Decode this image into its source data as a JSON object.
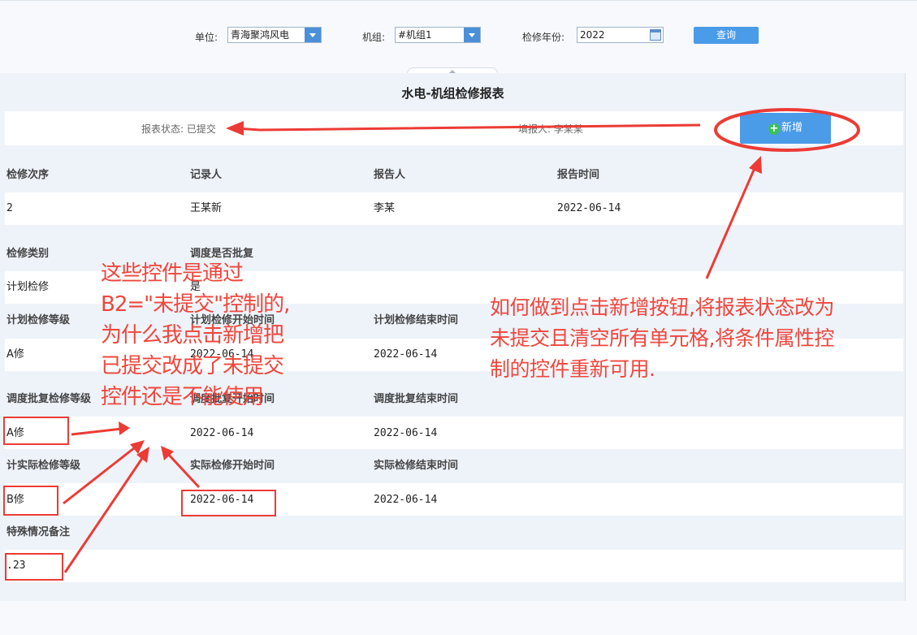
{
  "filters": {
    "unit_label": "单位:",
    "unit_value": "青海聚鸿风电",
    "unit_label_text": "单位:",
    "group_label": "机组:",
    "group_value": "#机组1",
    "year_label": "检修年份:",
    "year_value": "2022",
    "query_label": "查询"
  },
  "report": {
    "title": "水电-机组检修报表",
    "status": "报表状态: 已提交",
    "filler": "填报人: 李某某",
    "add_label": "新增"
  },
  "sections": {
    "s1": {
      "headers": [
        "检修次序",
        "记录人",
        "报告人",
        "报告时间"
      ],
      "values": [
        "2",
        "王某新",
        "李某",
        "2022-06-14"
      ]
    },
    "s2": {
      "headers": [
        "检修类别",
        "调度是否批复"
      ],
      "values": [
        "计划检修",
        "是"
      ]
    },
    "s3": {
      "headers": [
        "计划检修等级",
        "计划检修开始时间",
        "计划检修结束时间"
      ],
      "values": [
        "A修",
        "2022-06-14",
        "2022-06-14"
      ]
    },
    "s4": {
      "headers": [
        "调度批复检修等级",
        "调度批复开始时间",
        "调度批复结束时间"
      ],
      "values": [
        "A修",
        "2022-06-14",
        "2022-06-14"
      ]
    },
    "s5": {
      "headers": [
        "计实际检修等级",
        "实际检修开始时间",
        "实际检修结束时间"
      ],
      "values": [
        "B修",
        "2022-06-14",
        "2022-06-14"
      ]
    },
    "s6": {
      "headers": [
        "特殊情况备注"
      ],
      "values": [
        ".23"
      ]
    }
  },
  "annotations": {
    "left": [
      "这些控件是通过",
      "B2=\"未提交\"控制的,",
      "为什么我点击新增把",
      "已提交改成了未提交",
      "控件还是不能使用"
    ],
    "right": [
      "如何做到点击新增按钮,将报表状态改为",
      "未提交且清空所有单元格,将条件属性控",
      "制的控件重新可用."
    ]
  },
  "colors": {
    "accent": "#4a9be8",
    "annotation": "#f0463c",
    "add_icon": "#3cbf5a"
  }
}
